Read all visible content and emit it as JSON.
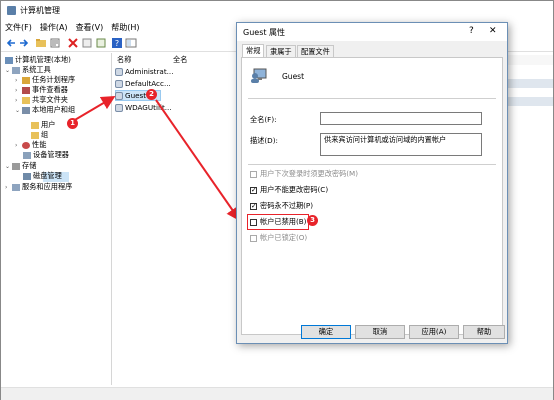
{
  "main": {
    "title": "计算机管理",
    "menus": [
      "文件(F)",
      "操作(A)",
      "查看(V)",
      "帮助(H)"
    ],
    "tree": {
      "root": "计算机管理(本地)",
      "system_tools": "系统工具",
      "task_scheduler": "任务计划程序",
      "event_viewer": "事件查看器",
      "shared_folders": "共享文件夹",
      "local_users_groups": "本地用户和组",
      "users": "用户",
      "groups": "组",
      "performance": "性能",
      "device_manager": "设备管理器",
      "storage": "存储",
      "disk_management": "磁盘管理",
      "services_apps": "服务和应用程序"
    },
    "list": {
      "col_name": "名称",
      "col_fullname": "全名",
      "rows": [
        "Administrat...",
        "DefaultAcc...",
        "Guest",
        "WDAGUtilit..."
      ]
    }
  },
  "dialog": {
    "title": "Guest 属性",
    "help_glyph": "?",
    "close_glyph": "✕",
    "tabs": [
      "常规",
      "隶属于",
      "配置文件"
    ],
    "username": "Guest",
    "fullname_label": "全名(F):",
    "fullname_value": "",
    "desc_label": "描述(D):",
    "desc_value": "供来宾访问计算机或访问域的内置帐户",
    "checkboxes": {
      "must_change": "用户下次登录时须更改密码(M)",
      "cannot_change": "用户不能更改密码(C)",
      "never_expires": "密码永不过期(P)",
      "disabled": "帐户已禁用(B)",
      "locked": "帐户已锁定(O)"
    },
    "buttons": {
      "ok": "确定",
      "cancel": "取消",
      "apply": "应用(A)",
      "help": "帮助"
    }
  },
  "annotations": {
    "b1": "1",
    "b2": "2",
    "b3": "3"
  },
  "colors": {
    "accent": "#0078d7",
    "marker": "#e8232a",
    "selection": "#cce4f7"
  }
}
